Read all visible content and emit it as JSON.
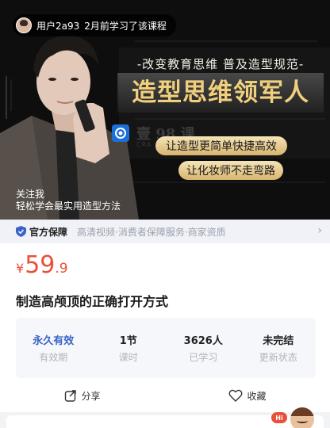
{
  "banner": {
    "notice": {
      "user": "用户2a93",
      "text": "2月前学习了该课程"
    },
    "slogan": "-改变教育思维 普及造型规范-",
    "headline": "造型思维领军人",
    "watermark": "壹 98 课",
    "watermark_sub": "CRA",
    "pill_1": "让造型更简单快捷高效",
    "pill_2": "让化妆师不走弯路",
    "caption_1": "关注我",
    "caption_2": "轻松学会最实用造型方法"
  },
  "guarantee": {
    "label": "官方保障",
    "description": "高清视频·消费者保障服务·商家资质",
    "chevron_icon": "chevron-right-icon"
  },
  "course": {
    "currency": "¥",
    "price_int": "59",
    "price_dec": ".9",
    "title": "制造高颅顶的正确打开方式",
    "stats": [
      {
        "value": "永久有效",
        "key": "有效期"
      },
      {
        "value": "1节",
        "key": "课时"
      },
      {
        "value": "3626人",
        "key": "已学习"
      },
      {
        "value": "未完结",
        "key": "更新状态"
      }
    ]
  },
  "actions": {
    "share": "分享",
    "favorite": "收藏"
  },
  "floating": {
    "hi": "Hi"
  },
  "colors": {
    "price": "#e8503a",
    "accent_blue": "#3a64c6",
    "gold": "#f0cf7d"
  }
}
